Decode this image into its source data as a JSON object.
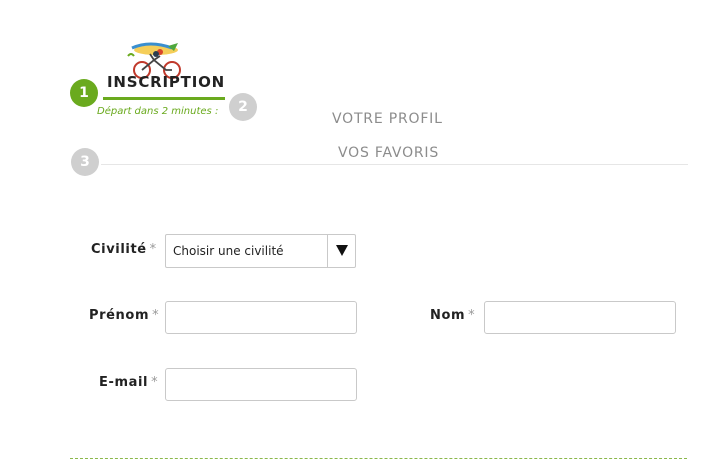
{
  "stepper": {
    "steps": [
      {
        "number": "1",
        "label": "INSCRIPTION",
        "subtitle": "Départ dans 2 minutes :",
        "active": true
      },
      {
        "number": "2",
        "label": "VOTRE PROFIL",
        "active": false
      },
      {
        "number": "3",
        "label": "VOS FAVORIS",
        "active": false
      }
    ]
  },
  "form": {
    "required_mark": "*",
    "civilite": {
      "label": "Civilité",
      "selected": "Choisir une civilité"
    },
    "prenom": {
      "label": "Prénom",
      "value": ""
    },
    "nom": {
      "label": "Nom",
      "value": ""
    },
    "email": {
      "label": "E-mail",
      "value": ""
    }
  },
  "colors": {
    "accent": "#6aaa1e",
    "inactive": "#cfcfcf"
  }
}
